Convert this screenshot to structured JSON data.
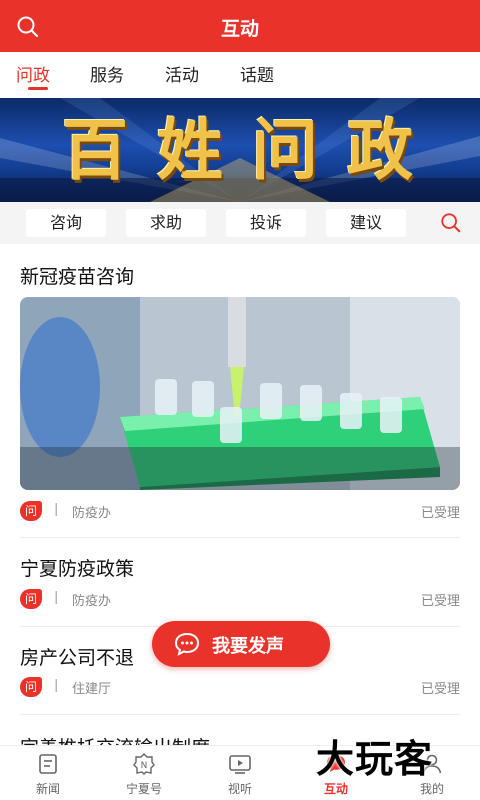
{
  "header": {
    "title": "互动"
  },
  "tabs": [
    {
      "label": "问政",
      "active": true
    },
    {
      "label": "服务",
      "active": false
    },
    {
      "label": "活动",
      "active": false
    },
    {
      "label": "话题",
      "active": false
    }
  ],
  "banner": {
    "words": [
      "百",
      "姓",
      "问",
      "政"
    ]
  },
  "categories": [
    "咨询",
    "求助",
    "投诉",
    "建议"
  ],
  "items": [
    {
      "title": "新冠疫苗咨询",
      "badge": "问",
      "separator": "|",
      "dept": "防疫办",
      "status": "已受理"
    },
    {
      "title": "宁夏防疫政策",
      "badge": "问",
      "separator": "|",
      "dept": "防疫办",
      "status": "已受理"
    },
    {
      "title": "房产公司不退",
      "badge": "问",
      "separator": "|",
      "dept": "住建厅",
      "status": "已受理"
    },
    {
      "title": "完善推托交流输出制度"
    }
  ],
  "fab": {
    "label": "我要发声"
  },
  "tabbar": [
    {
      "label": "新闻",
      "icon": "news-icon",
      "active": false
    },
    {
      "label": "宁夏号",
      "icon": "ningxia-hao-icon",
      "active": false
    },
    {
      "label": "视听",
      "icon": "video-icon",
      "active": false
    },
    {
      "label": "互动",
      "icon": "interaction-icon",
      "active": true
    },
    {
      "label": "我的",
      "icon": "profile-icon",
      "active": false
    }
  ],
  "watermark": "大玩客",
  "colors": {
    "brand": "#e8322a",
    "banner_gold": "#f0c24a",
    "banner_blue": "#1d4fb0"
  }
}
